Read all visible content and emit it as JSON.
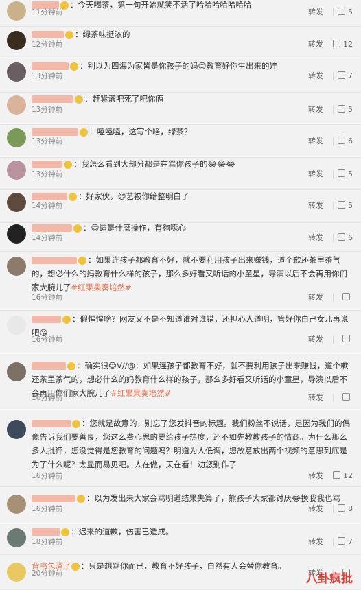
{
  "comments": [
    {
      "time": "11分钟前",
      "text": "今天喝茶，第一句开始就笑不活了哈哈哈哈哈哈哈",
      "like": "5",
      "repost": "转发",
      "avatar_color": "#c9b28a",
      "name_hint_color": "#f4b8a8"
    },
    {
      "time": "12分钟前",
      "text": "绿茶味挺浓的",
      "like": "12",
      "repost": "转发",
      "avatar_color": "#3a2c1e",
      "name_hint_color": "#f4b8a8"
    },
    {
      "time": "13分钟前",
      "text": "别以为四海为家皆是你孩子的妈😊教育好你生出来的娃",
      "like": "7",
      "repost": "转发",
      "avatar_color": "#6a5e63",
      "name_hint_color": "#f4b8a8"
    },
    {
      "time": "13分钟前",
      "text": "赶紧滚吧死了吧你俩",
      "like": "5",
      "repost": "转发",
      "avatar_color": "#d9b49a",
      "name_hint_color": "#f4b8a8"
    },
    {
      "time": "13分钟前",
      "text": "嗑嗑嗑，这写个啥，绿茶？",
      "like": "6",
      "repost": "转发",
      "avatar_color": "#7b9a5a",
      "name_hint_color": "#f4b8a8"
    },
    {
      "time": "13分钟前",
      "text": "我怎么看到大部分都是在骂你孩子的😂😂😂",
      "like": "5",
      "repost": "转发",
      "avatar_color": "#b8929c",
      "name_hint_color": "#f4b8a8"
    },
    {
      "time": "14分钟前",
      "text": "好家伙，😊艺被你给整明白了",
      "like": "5",
      "repost": "转发",
      "avatar_color": "#5d4a3c",
      "name_hint_color": "#f4b8a8"
    },
    {
      "time": "14分钟前",
      "text": "😊這是什麼操作，有夠噁心",
      "like": "6",
      "repost": "转发",
      "avatar_color": "#222222",
      "name_hint_color": "#f4b8a8"
    },
    {
      "time": "16分钟前",
      "text": "如果连孩子都教育不好，就不要利用孩子出来赚钱，道个歉还茶里茶气的，想必什么的妈教育什么样的孩子，那么多好看又听话的小童星，导演以后不会再用你们家大腕儿了",
      "tag": "#红果果奏培然#",
      "like": "",
      "repost": "转发",
      "avatar_color": "#8c7b6a",
      "name_hint_color": "#f4b8a8"
    },
    {
      "time": "16分钟前",
      "text": "假惺惺啥？网友又不是不知道谁对谁错，还担心人道明，管好你自己女儿再说吧😘",
      "like": "",
      "repost": "转发",
      "avatar_color": "#e8e8e8",
      "name_hint_color": "#f4b8a8"
    },
    {
      "time": "16分钟前",
      "text": "确实很😊V//@：如果连孩子都教育不好，就不要利用孩子出来赚钱，道个歉还茶里茶气的，想必什么的妈教育什么样的孩子，那么多好看又听话的小童星，导演以后不会再用你们家大腕儿了",
      "tag": "#红果果奏培然#",
      "like": "",
      "repost": "转发",
      "avatar_color": "#7a7065",
      "name_hint_color": "#f4b8a8"
    },
    {
      "time": "16分钟前",
      "text": "您就是故意的，别忘了您发抖音的标题。我们粉丝不说话，是因为我们的偶像告诉我们要善良，您这么费心思的要给孩子热度，还不如先教教孩子的情商。为什么那么多人批评，您没觉得是您教育的问题吗？明道为人低调，您故意放出两个视频的意思到底是为了什么呢？太显而易见吧。人在做，天在看！劝您别作了",
      "like": "12",
      "repost": "转发",
      "avatar_color": "#3c4a5c",
      "name_hint_color": "#f4b8a8"
    },
    {
      "time": "16分钟前",
      "text": "以为发出来大家会骂明道结果失算了，熊孩子大家都讨厌😂换我我也骂",
      "like": "8",
      "repost": "转发",
      "avatar_color": "#a89078",
      "name_hint_color": "#f4b8a8"
    },
    {
      "time": "18分钟前",
      "text": "迟来的道歉，伤害已造成。",
      "like": "7",
      "repost": "转发",
      "avatar_color": "#6b7a72",
      "name_hint_color": "#f4b8a8"
    },
    {
      "time": "20分钟前",
      "text": "只是想骂你而已，教育不好孩子，自然有人会替你教育。",
      "name": "背书包溜了",
      "like": "",
      "repost": "转发",
      "avatar_color": "#e8c860",
      "name_hint_color": "#f4b8a8"
    }
  ],
  "watermark": "八卦疯批"
}
